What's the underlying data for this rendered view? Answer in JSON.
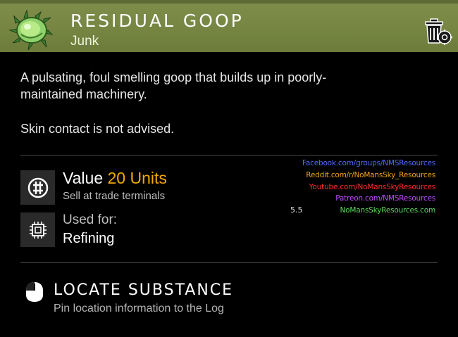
{
  "item": {
    "name": "RESIDUAL GOOP",
    "category": "Junk",
    "icon": "goop-icon"
  },
  "description": {
    "paragraph1": "A pulsating, foul smelling goop that builds up in poorly-maintained machinery.",
    "paragraph2": "Skin contact is not advised."
  },
  "value": {
    "label": "Value",
    "amount": "20 Units",
    "subtitle": "Sell at trade terminals",
    "icon": "units-icon"
  },
  "used_for": {
    "label": "Used for:",
    "value": "Refining",
    "icon": "processor-chip-icon"
  },
  "watermark": {
    "links": [
      {
        "text": "Facebook.com/groups/NMSResources",
        "color": "#4f6bff"
      },
      {
        "text": "Reddit.com/r/NoMansSky_Resources",
        "color": "#f2a21b"
      },
      {
        "text": "Youtube.com/NoMansSkyResources",
        "color": "#ff2a2a"
      },
      {
        "text": "Patreon.com/NMSResources",
        "color": "#c04bff"
      },
      {
        "text": "NoMansSkyResources.com",
        "color": "#5ed65e"
      }
    ],
    "version": "5.5"
  },
  "locate": {
    "title": "LOCATE SUBSTANCE",
    "subtitle": "Pin location information to the Log",
    "icon": "mouse-icon"
  },
  "actions": {
    "trash_icon": "trash-gear-icon"
  },
  "colors": {
    "header_bg": "#768542",
    "accent_value": "#f2a900",
    "background": "#000000"
  }
}
